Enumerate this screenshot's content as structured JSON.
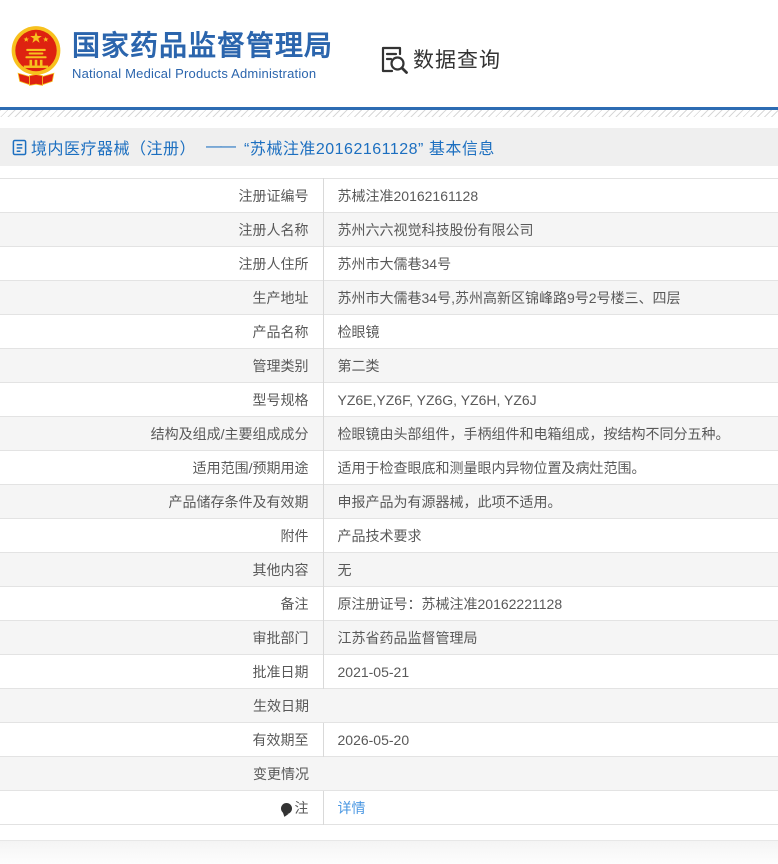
{
  "header": {
    "agency_cn": "国家药品监督管理局",
    "agency_en": "National Medical Products Administration",
    "nav_label": "数据查询"
  },
  "breadcrumb": {
    "section": "境内医疗器械（注册）",
    "dash": "——",
    "title": "“苏械注准20162161128” 基本信息"
  },
  "table": {
    "rows": [
      {
        "label": "注册证编号",
        "value": "苏械注准20162161128"
      },
      {
        "label": "注册人名称",
        "value": "苏州六六视觉科技股份有限公司"
      },
      {
        "label": "注册人住所",
        "value": "苏州市大儒巷34号"
      },
      {
        "label": "生产地址",
        "value": "苏州市大儒巷34号,苏州高新区锦峰路9号2号楼三、四层"
      },
      {
        "label": "产品名称",
        "value": "检眼镜"
      },
      {
        "label": "管理类别",
        "value": "第二类"
      },
      {
        "label": "型号规格",
        "value": "YZ6E,YZ6F, YZ6G, YZ6H, YZ6J"
      },
      {
        "label": "结构及组成/主要组成成分",
        "value": "检眼镜由头部组件，手柄组件和电箱组成，按结构不同分五种。"
      },
      {
        "label": "适用范围/预期用途",
        "value": "适用于检查眼底和测量眼内异物位置及病灶范围。"
      },
      {
        "label": "产品储存条件及有效期",
        "value": "申报产品为有源器械，此项不适用。"
      },
      {
        "label": "附件",
        "value": "产品技术要求"
      },
      {
        "label": "其他内容",
        "value": "无"
      },
      {
        "label": "备注",
        "value": "原注册证号：苏械注准20162221128"
      },
      {
        "label": "审批部门",
        "value": "江苏省药品监督管理局"
      },
      {
        "label": "批准日期",
        "value": "2021-05-21"
      },
      {
        "label": "生效日期",
        "value": ""
      },
      {
        "label": "有效期至",
        "value": "2026-05-20"
      },
      {
        "label": "变更情况",
        "value": ""
      },
      {
        "label": "注",
        "value": "详情",
        "link": true,
        "icon": "note-balloon-icon"
      }
    ]
  },
  "colors": {
    "brand_blue": "#2b65ad",
    "accent_blue": "#1c6fc0",
    "link_blue": "#4a97e2",
    "divider_blue": "#2d6cb3",
    "band_gray": "#efefef",
    "row_alt_gray": "#f5f5f5",
    "emblem_red": "#de2210",
    "emblem_gold": "#f7c11e",
    "text_dark": "#333333",
    "text_gray": "#595959"
  }
}
